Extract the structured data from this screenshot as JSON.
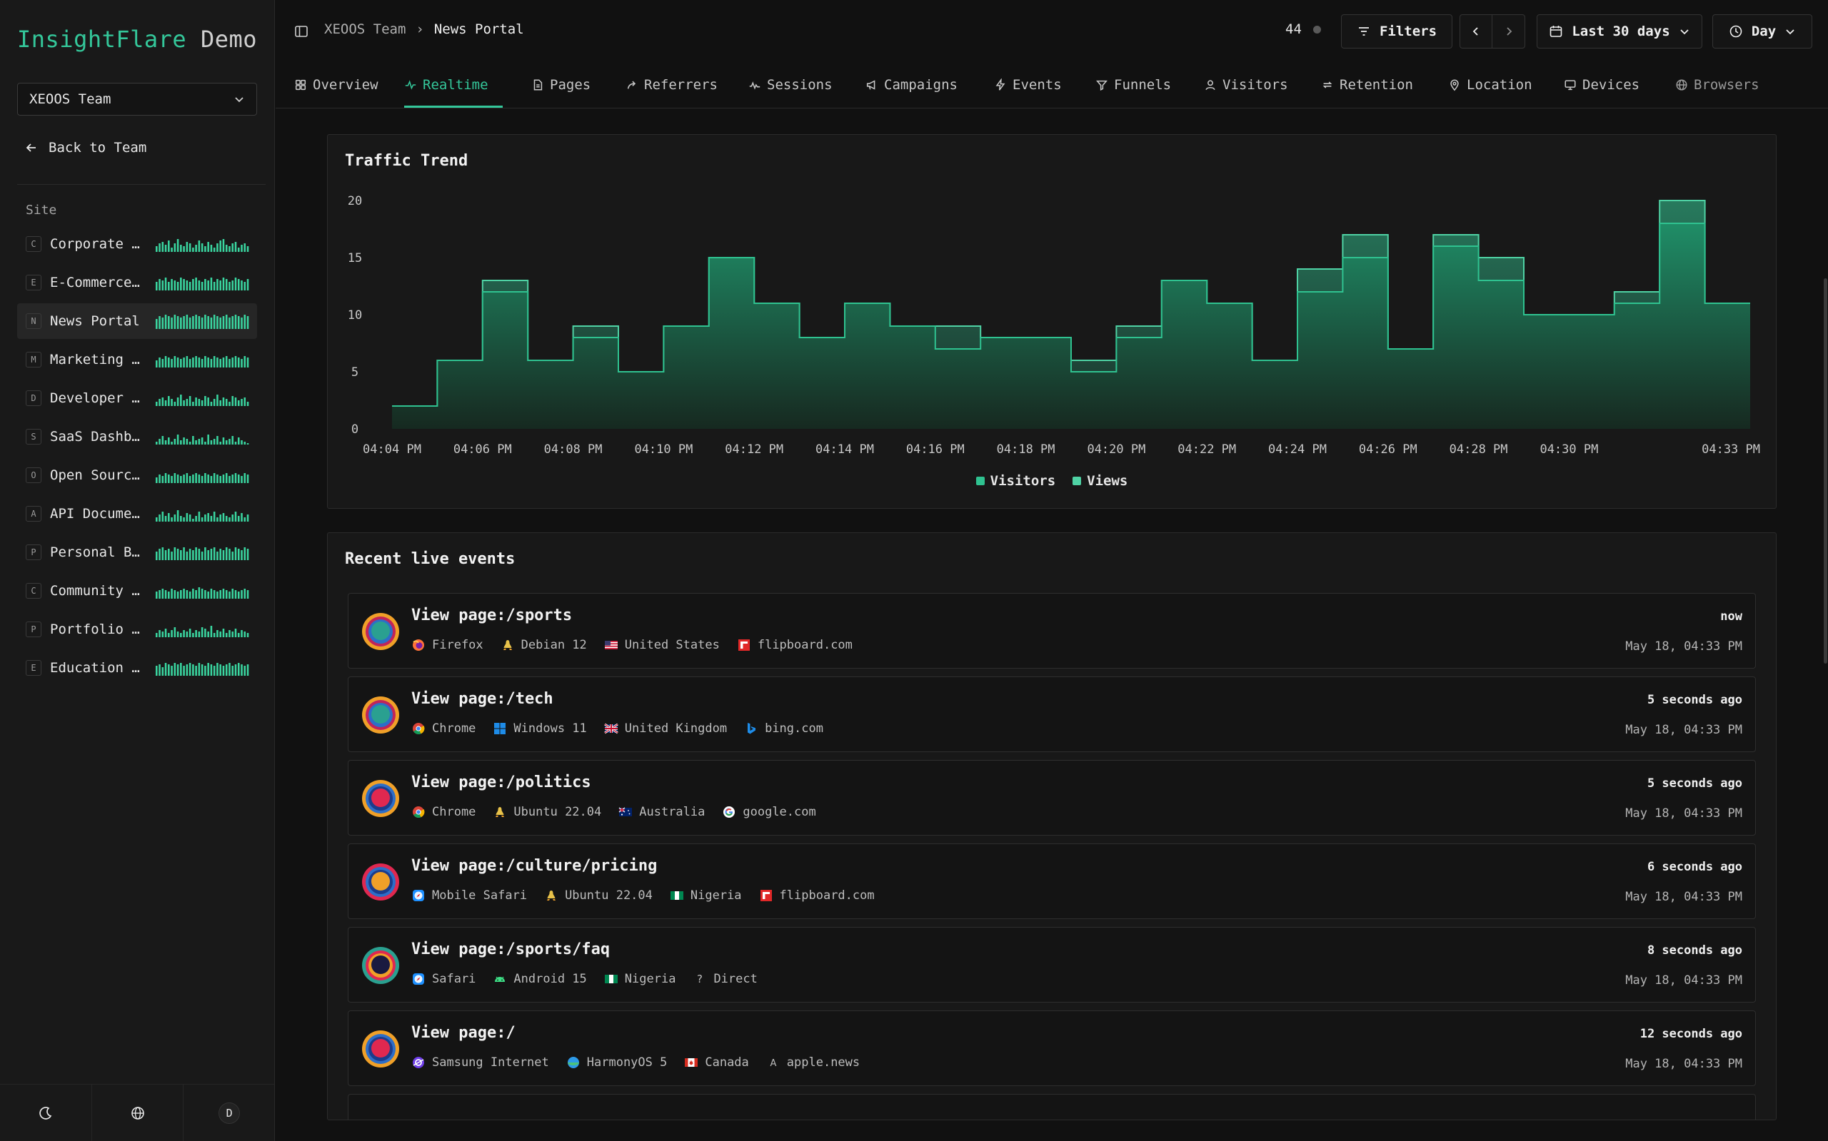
{
  "app": {
    "brand_primary": "InsightFlare",
    "brand_secondary": "Demo"
  },
  "colors": {
    "accent": "#34c79a",
    "visitors": "#2fc290",
    "views": "#4fd2a4"
  },
  "sidebar": {
    "team_select": "XEOOS Team",
    "back_label": "Back to Team",
    "site_label": "Site",
    "sites": [
      {
        "letter": "C",
        "name": "Corporate Website",
        "spark": [
          4,
          6,
          7,
          5,
          8,
          3,
          6,
          9,
          5,
          4,
          7,
          6,
          3,
          5,
          8,
          6,
          4,
          7,
          5,
          3,
          6,
          8,
          9,
          5,
          4,
          6,
          7,
          3,
          5,
          6,
          4
        ]
      },
      {
        "letter": "E",
        "name": "E-Commerce Store",
        "spark": [
          6,
          8,
          7,
          9,
          6,
          8,
          7,
          6,
          9,
          8,
          7,
          6,
          8,
          9,
          7,
          6,
          8,
          7,
          9,
          6,
          8,
          7,
          9,
          8,
          6,
          7,
          9,
          8,
          7,
          6,
          8
        ]
      },
      {
        "letter": "N",
        "name": "News Portal",
        "spark": [
          7,
          9,
          8,
          10,
          9,
          8,
          10,
          9,
          8,
          9,
          10,
          8,
          9,
          10,
          9,
          8,
          10,
          9,
          8,
          10,
          9,
          8,
          9,
          10,
          8,
          9,
          10,
          9,
          8,
          10,
          9
        ]
      },
      {
        "letter": "M",
        "name": "Marketing Landing",
        "spark": [
          5,
          7,
          6,
          8,
          7,
          6,
          8,
          7,
          6,
          7,
          8,
          6,
          7,
          8,
          7,
          6,
          8,
          7,
          6,
          8,
          7,
          6,
          7,
          8,
          6,
          7,
          8,
          7,
          6,
          8,
          7
        ]
      },
      {
        "letter": "D",
        "name": "Developer Docs",
        "spark": [
          3,
          5,
          6,
          4,
          7,
          5,
          3,
          6,
          8,
          4,
          5,
          7,
          3,
          6,
          5,
          4,
          7,
          6,
          3,
          5,
          8,
          4,
          6,
          5,
          3,
          7,
          6,
          4,
          5,
          6,
          3
        ]
      },
      {
        "letter": "S",
        "name": "SaaS Dashboard",
        "spark": [
          2,
          4,
          6,
          3,
          5,
          2,
          4,
          7,
          3,
          5,
          4,
          2,
          6,
          3,
          4,
          5,
          2,
          7,
          3,
          4,
          6,
          2,
          5,
          3,
          4,
          6,
          2,
          5,
          3,
          2,
          1
        ]
      },
      {
        "letter": "O",
        "name": "Open Source Project",
        "spark": [
          4,
          6,
          5,
          7,
          6,
          5,
          7,
          6,
          5,
          6,
          7,
          5,
          6,
          7,
          6,
          5,
          7,
          6,
          5,
          7,
          6,
          5,
          6,
          7,
          5,
          6,
          7,
          6,
          5,
          7,
          6
        ]
      },
      {
        "letter": "A",
        "name": "API Documentation",
        "spark": [
          3,
          5,
          7,
          4,
          6,
          3,
          5,
          8,
          4,
          3,
          6,
          5,
          2,
          4,
          7,
          3,
          5,
          6,
          4,
          7,
          3,
          5,
          6,
          4,
          3,
          5,
          7,
          4,
          6,
          3,
          5
        ]
      },
      {
        "letter": "P",
        "name": "Personal Blog",
        "spark": [
          6,
          8,
          9,
          7,
          8,
          6,
          9,
          8,
          7,
          9,
          6,
          8,
          7,
          9,
          8,
          6,
          9,
          7,
          8,
          9,
          6,
          8,
          7,
          9,
          8,
          6,
          9,
          8,
          7,
          9,
          8
        ]
      },
      {
        "letter": "C",
        "name": "Community Forum",
        "spark": [
          5,
          6,
          7,
          6,
          5,
          7,
          6,
          5,
          6,
          7,
          6,
          5,
          7,
          6,
          8,
          7,
          6,
          5,
          7,
          6,
          5,
          6,
          7,
          6,
          5,
          7,
          6,
          5,
          6,
          7,
          6
        ]
      },
      {
        "letter": "P",
        "name": "Portfolio Site",
        "spark": [
          3,
          5,
          4,
          6,
          3,
          5,
          7,
          4,
          3,
          5,
          4,
          6,
          3,
          5,
          4,
          7,
          6,
          4,
          8,
          3,
          5,
          4,
          6,
          3,
          5,
          4,
          6,
          3,
          5,
          4,
          3
        ]
      },
      {
        "letter": "E",
        "name": "Education Platform",
        "spark": [
          7,
          8,
          6,
          9,
          8,
          7,
          9,
          8,
          9,
          7,
          8,
          9,
          8,
          7,
          9,
          8,
          7,
          9,
          8,
          7,
          9,
          8,
          7,
          8,
          9,
          7,
          8,
          9,
          8,
          7,
          8
        ]
      }
    ]
  },
  "header": {
    "crumb_team": "XEOOS Team",
    "crumb_sep": "›",
    "crumb_site": "News Portal",
    "online_count": "44",
    "filters_label": "Filters",
    "range_label": "Last 30 days",
    "interval_label": "Day"
  },
  "tabs": [
    {
      "label": "Overview",
      "icon": "grid-icon"
    },
    {
      "label": "Realtime",
      "icon": "activity-icon"
    },
    {
      "label": "Pages",
      "icon": "file-icon"
    },
    {
      "label": "Referrers",
      "icon": "share-icon"
    },
    {
      "label": "Sessions",
      "icon": "pulse-icon"
    },
    {
      "label": "Campaigns",
      "icon": "megaphone-icon"
    },
    {
      "label": "Events",
      "icon": "bolt-icon"
    },
    {
      "label": "Funnels",
      "icon": "funnel-icon"
    },
    {
      "label": "Visitors",
      "icon": "user-icon"
    },
    {
      "label": "Retention",
      "icon": "repeat-icon"
    },
    {
      "label": "Location",
      "icon": "pin-icon"
    },
    {
      "label": "Devices",
      "icon": "monitor-icon"
    },
    {
      "label": "Browsers",
      "icon": "globe-icon"
    }
  ],
  "chart_data": {
    "type": "area",
    "step": true,
    "title": "Traffic Trend",
    "x": [
      "04:04 PM",
      "04:05 PM",
      "04:06 PM",
      "04:07 PM",
      "04:08 PM",
      "04:09 PM",
      "04:10 PM",
      "04:11 PM",
      "04:12 PM",
      "04:13 PM",
      "04:14 PM",
      "04:15 PM",
      "04:16 PM",
      "04:17 PM",
      "04:18 PM",
      "04:19 PM",
      "04:20 PM",
      "04:21 PM",
      "04:22 PM",
      "04:23 PM",
      "04:24 PM",
      "04:25 PM",
      "04:26 PM",
      "04:27 PM",
      "04:28 PM",
      "04:29 PM",
      "04:30 PM",
      "04:31 PM",
      "04:32 PM",
      "04:33 PM"
    ],
    "x_tick_labels": [
      "04:04 PM",
      "04:06 PM",
      "04:08 PM",
      "04:10 PM",
      "04:12 PM",
      "04:14 PM",
      "04:16 PM",
      "04:18 PM",
      "04:20 PM",
      "04:22 PM",
      "04:24 PM",
      "04:26 PM",
      "04:28 PM",
      "04:30 PM",
      "04:33 PM"
    ],
    "series": [
      {
        "name": "Visitors",
        "values": [
          2,
          6,
          12,
          6,
          8,
          5,
          9,
          15,
          11,
          8,
          11,
          9,
          7,
          8,
          8,
          5,
          8,
          13,
          11,
          6,
          12,
          15,
          7,
          16,
          13,
          10,
          10,
          11,
          18,
          11
        ]
      },
      {
        "name": "Views",
        "values": [
          2,
          6,
          13,
          6,
          9,
          5,
          9,
          15,
          11,
          8,
          11,
          9,
          9,
          8,
          8,
          6,
          9,
          13,
          11,
          6,
          14,
          17,
          7,
          17,
          15,
          10,
          10,
          12,
          20,
          11
        ]
      }
    ],
    "ylim": [
      0,
      20
    ],
    "yticks": [
      0,
      5,
      10,
      15,
      20
    ],
    "legend": "bottom-center",
    "grid": false
  },
  "events": {
    "title": "Recent live events",
    "items": [
      {
        "title": "View page:/sports",
        "ago": "now",
        "time": "May 18, 04:33 PM",
        "avatar": [
          "#f0a028",
          "#c0245a",
          "#2d6ec8",
          "#2aa090"
        ],
        "browser": {
          "icon": "firefox-icon",
          "label": "Firefox"
        },
        "os": {
          "icon": "linux-icon",
          "label": "Debian 12"
        },
        "country": {
          "icon": "flag-us-icon",
          "label": "United States"
        },
        "source": {
          "icon": "flipboard-icon",
          "label": "flipboard.com"
        }
      },
      {
        "title": "View page:/tech",
        "ago": "5 seconds ago",
        "time": "May 18, 04:33 PM",
        "avatar": [
          "#f0a028",
          "#c0245a",
          "#2d6ec8",
          "#2aa090"
        ],
        "browser": {
          "icon": "chrome-icon",
          "label": "Chrome"
        },
        "os": {
          "icon": "windows-icon",
          "label": "Windows 11"
        },
        "country": {
          "icon": "flag-uk-icon",
          "label": "United Kingdom"
        },
        "source": {
          "icon": "bing-icon",
          "label": "bing.com"
        }
      },
      {
        "title": "View page:/politics",
        "ago": "5 seconds ago",
        "time": "May 18, 04:33 PM",
        "avatar": [
          "#f0a028",
          "#2d6ec8",
          "#1c3c8c",
          "#e02850"
        ],
        "browser": {
          "icon": "chrome-icon",
          "label": "Chrome"
        },
        "os": {
          "icon": "linux-icon",
          "label": "Ubuntu 22.04"
        },
        "country": {
          "icon": "flag-au-icon",
          "label": "Australia"
        },
        "source": {
          "icon": "google-icon",
          "label": "google.com"
        }
      },
      {
        "title": "View page:/culture/pricing",
        "ago": "6 seconds ago",
        "time": "May 18, 04:33 PM",
        "avatar": [
          "#e02850",
          "#2d6ec8",
          "#1c3c8c",
          "#f0a028"
        ],
        "browser": {
          "icon": "safari-icon",
          "label": "Mobile Safari"
        },
        "os": {
          "icon": "linux-icon",
          "label": "Ubuntu 22.04"
        },
        "country": {
          "icon": "flag-ng-icon",
          "label": "Nigeria"
        },
        "source": {
          "icon": "flipboard-icon",
          "label": "flipboard.com"
        }
      },
      {
        "title": "View page:/sports/faq",
        "ago": "8 seconds ago",
        "time": "May 18, 04:33 PM",
        "avatar": [
          "#2aa090",
          "#e02850",
          "#f0a028",
          "#1a1a40"
        ],
        "browser": {
          "icon": "safari-icon",
          "label": "Safari"
        },
        "os": {
          "icon": "android-icon",
          "label": "Android 15"
        },
        "country": {
          "icon": "flag-ng-icon",
          "label": "Nigeria"
        },
        "source": {
          "icon": "question-icon",
          "label": "Direct"
        }
      },
      {
        "title": "View page:/",
        "ago": "12 seconds ago",
        "time": "May 18, 04:33 PM",
        "avatar": [
          "#f0a028",
          "#2d6ec8",
          "#1c3c8c",
          "#e02850"
        ],
        "browser": {
          "icon": "samsung-internet-icon",
          "label": "Samsung Internet"
        },
        "os": {
          "icon": "harmonyos-icon",
          "label": "HarmonyOS 5"
        },
        "country": {
          "icon": "flag-ca-icon",
          "label": "Canada"
        },
        "source": {
          "icon": "apple-news-icon",
          "label": "apple.news"
        }
      }
    ]
  }
}
